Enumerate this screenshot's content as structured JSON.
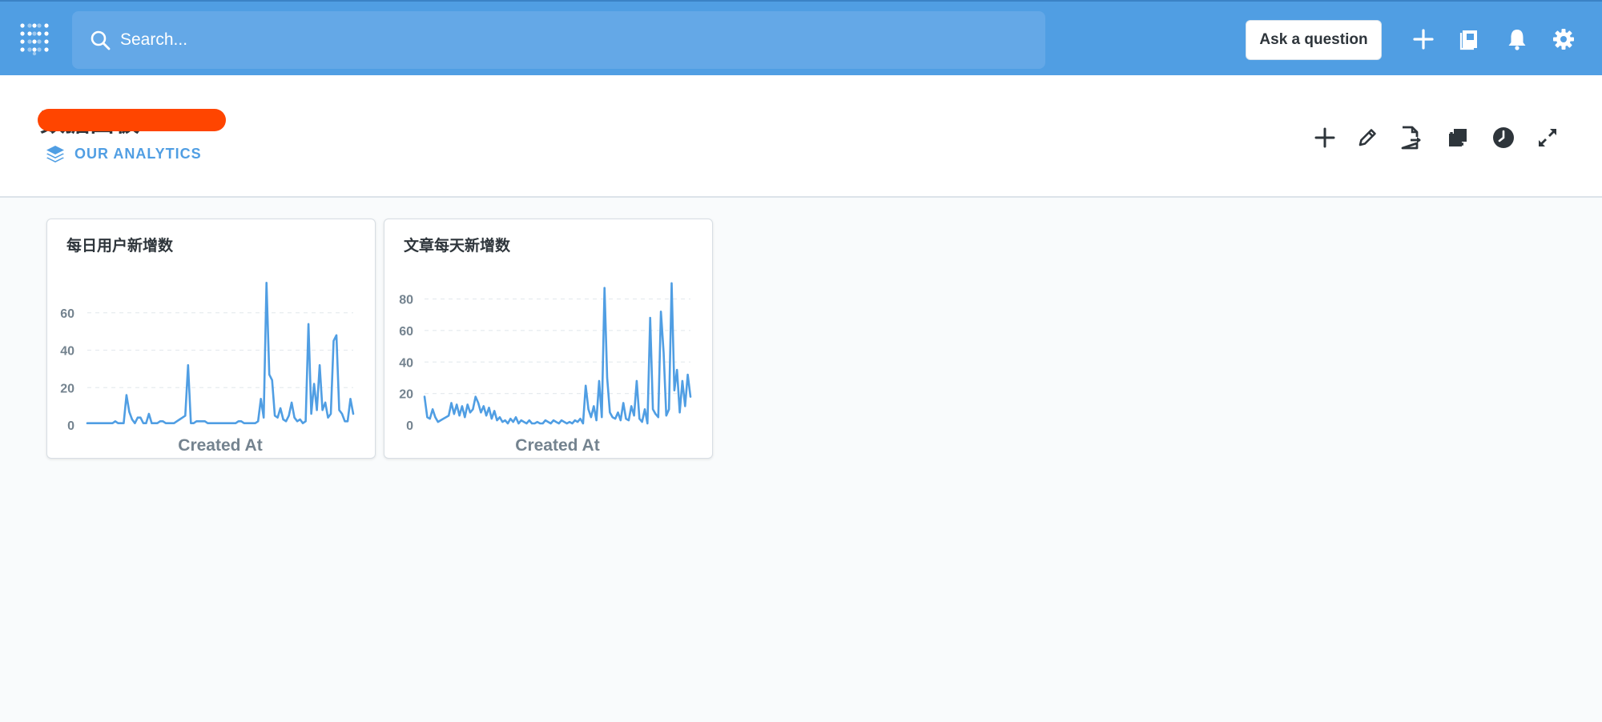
{
  "navbar": {
    "search_placeholder": "Search...",
    "ask_button_label": "Ask a question"
  },
  "dashboard": {
    "title": "数据面板",
    "collection_label": "OUR ANALYTICS"
  },
  "colors": {
    "brand": "#509ee3",
    "series": "#509ee3",
    "redaction": "#ff4500"
  },
  "cards": [
    {
      "title": "每日用户新增数",
      "chart_data": {
        "type": "line",
        "xlabel": "Created At",
        "ylabel": "",
        "ylim": [
          0,
          80
        ],
        "yticks": [
          0,
          20,
          40,
          60
        ],
        "grid": true,
        "series": [
          {
            "name": "",
            "values": [
              1,
              1,
              1,
              1,
              1,
              1,
              1,
              1,
              1,
              1,
              2,
              1,
              1,
              1,
              16,
              7,
              3,
              1,
              4,
              4,
              1,
              1,
              6,
              1,
              1,
              1,
              2,
              2,
              1,
              1,
              1,
              1,
              2,
              3,
              4,
              5,
              32,
              1,
              1,
              2,
              2,
              2,
              2,
              1,
              1,
              1,
              1,
              1,
              1,
              1,
              1,
              1,
              1,
              1,
              2,
              2,
              1,
              1,
              1,
              1,
              1,
              2,
              14,
              4,
              76,
              27,
              24,
              5,
              4,
              9,
              3,
              2,
              5,
              12,
              4,
              2,
              3,
              1,
              2,
              54,
              6,
              22,
              8,
              32,
              8,
              12,
              4,
              6,
              45,
              48,
              8,
              6,
              2,
              2,
              14,
              6
            ]
          }
        ]
      }
    },
    {
      "title": "文章每天新增数",
      "chart_data": {
        "type": "line",
        "xlabel": "Created At",
        "ylabel": "",
        "ylim": [
          0,
          95
        ],
        "yticks": [
          0,
          20,
          40,
          60,
          80
        ],
        "grid": true,
        "series": [
          {
            "name": "",
            "values": [
              18,
              5,
              4,
              10,
              5,
              2,
              3,
              4,
              5,
              6,
              14,
              7,
              13,
              6,
              12,
              5,
              13,
              8,
              10,
              18,
              14,
              8,
              12,
              6,
              11,
              4,
              9,
              3,
              5,
              2,
              3,
              1,
              4,
              2,
              5,
              1,
              3,
              2,
              1,
              3,
              1,
              1,
              2,
              1,
              1,
              3,
              2,
              1,
              3,
              2,
              1,
              3,
              2,
              1,
              2,
              1,
              3,
              2,
              4,
              1,
              25,
              10,
              5,
              12,
              3,
              28,
              5,
              87,
              30,
              8,
              5,
              4,
              8,
              3,
              14,
              4,
              3,
              12,
              6,
              28,
              4,
              2,
              10,
              1,
              68,
              10,
              7,
              5,
              72,
              46,
              6,
              10,
              90,
              22,
              35,
              8,
              28,
              12,
              32,
              18
            ]
          }
        ]
      }
    }
  ]
}
